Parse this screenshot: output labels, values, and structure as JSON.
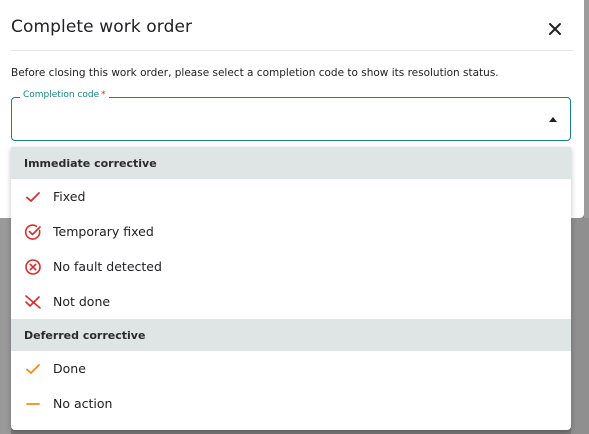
{
  "dialog": {
    "title": "Complete work order",
    "description": "Before closing this work order, please select a completion code to show its resolution status."
  },
  "field": {
    "label": "Completion code",
    "required_mark": "*",
    "value": ""
  },
  "groups": [
    {
      "label": "Immediate corrective",
      "options": [
        {
          "label": "Fixed",
          "icon": "check-icon"
        },
        {
          "label": "Temporary fixed",
          "icon": "circle-check-icon"
        },
        {
          "label": "No fault detected",
          "icon": "circle-x-icon"
        },
        {
          "label": "Not done",
          "icon": "crossed-check-icon"
        }
      ]
    },
    {
      "label": "Deferred corrective",
      "options": [
        {
          "label": "Done",
          "icon": "check-icon"
        },
        {
          "label": "No action",
          "icon": "dash-icon"
        }
      ]
    }
  ],
  "colors": {
    "accent": "#1a7f86",
    "immediate_icon": "#d32f2f",
    "deferred_icon": "#f08c1a",
    "group_header_bg": "#dfe4e5"
  }
}
